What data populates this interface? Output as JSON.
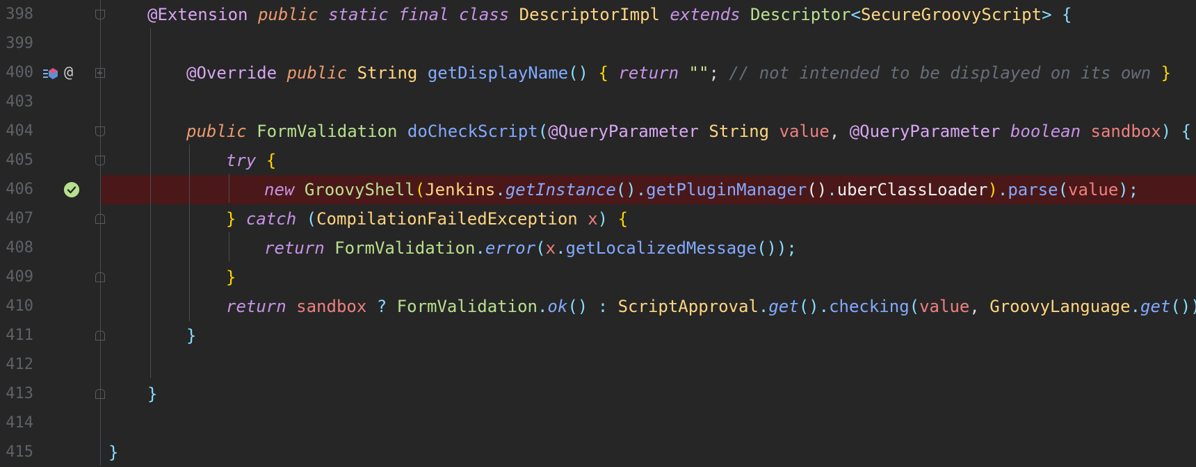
{
  "editor": {
    "gutter": {
      "line_numbers": [
        "398",
        "399",
        "400",
        "403",
        "404",
        "405",
        "406",
        "407",
        "408",
        "409",
        "410",
        "411",
        "412",
        "413",
        "414",
        "415"
      ],
      "icons": {
        "override_marker": "override-implements-icon",
        "annotation_marker": "@",
        "breakpoint_verified": "check-circle-icon"
      }
    },
    "colors": {
      "background": "#262626",
      "breakpoint_line": "#4a1819",
      "line_numbers": "#5e6268",
      "keyword": "#c793e6",
      "class": "#ffd580",
      "method": "#82aaff",
      "comment": "#676e78"
    },
    "code": {
      "l398": {
        "t1": "@Extension",
        "t2": "public",
        "t3": "static",
        "t4": "final",
        "t5": "class",
        "t6": "DescriptorImpl",
        "t7": "extends",
        "t8": "Descriptor",
        "t9": "<",
        "t10": "SecureGroovyScript",
        "t11": ">",
        "t12": "{"
      },
      "l400": {
        "t1": "@Override",
        "t2": "public",
        "t3": "String",
        "t4": "getDisplayName",
        "t5": "()",
        "t6": "{",
        "t7": "return",
        "t8": "\"\"",
        "t9": ";",
        "t10": "// not intended to be displayed on its own",
        "t11": "}"
      },
      "l404": {
        "t1": "public",
        "t2": "FormValidation",
        "t3": "doCheckScript",
        "t4": "(",
        "t5": "@QueryParameter",
        "t6": "String",
        "t7": "value",
        "t8": ",",
        "t9": "@QueryParameter",
        "t10": "boolean",
        "t11": "sandbox",
        "t12": ")",
        "t13": "{"
      },
      "l405": {
        "t1": "try",
        "t2": "{"
      },
      "l406": {
        "t1": "new",
        "t2": "GroovyShell",
        "t3": "(",
        "t4": "Jenkins",
        "t5": ".",
        "t6": "getInstance",
        "t7": "()",
        "t8": ".",
        "t9": "getPluginManager",
        "t10": "()",
        "t11": ".",
        "t12": "uberClassLoader",
        "t13": ")",
        "t14": ".",
        "t15": "parse",
        "t16": "(",
        "t17": "value",
        "t18": ");"
      },
      "l407": {
        "t1": "}",
        "t2": "catch",
        "t3": "(",
        "t4": "CompilationFailedException",
        "t5": "x",
        "t6": ")",
        "t7": "{"
      },
      "l408": {
        "t1": "return",
        "t2": "FormValidation",
        "t3": ".",
        "t4": "error",
        "t5": "(",
        "t6": "x",
        "t7": ".",
        "t8": "getLocalizedMessage",
        "t9": "());"
      },
      "l409": {
        "t1": "}"
      },
      "l410": {
        "t1": "return",
        "t2": "sandbox",
        "t3": "?",
        "t4": "FormValidation",
        "t5": ".",
        "t6": "ok",
        "t7": "()",
        "t8": ":",
        "t9": "ScriptApproval",
        "t10": ".",
        "t11": "get",
        "t12": "()",
        "t13": ".",
        "t14": "checking",
        "t15": "(",
        "t16": "value",
        "t17": ",",
        "t18": "GroovyLanguage",
        "t19": ".",
        "t20": "get",
        "t21": "());"
      },
      "l411": {
        "t1": "}"
      },
      "l413": {
        "t1": "}"
      },
      "l415": {
        "t1": "}"
      }
    }
  }
}
